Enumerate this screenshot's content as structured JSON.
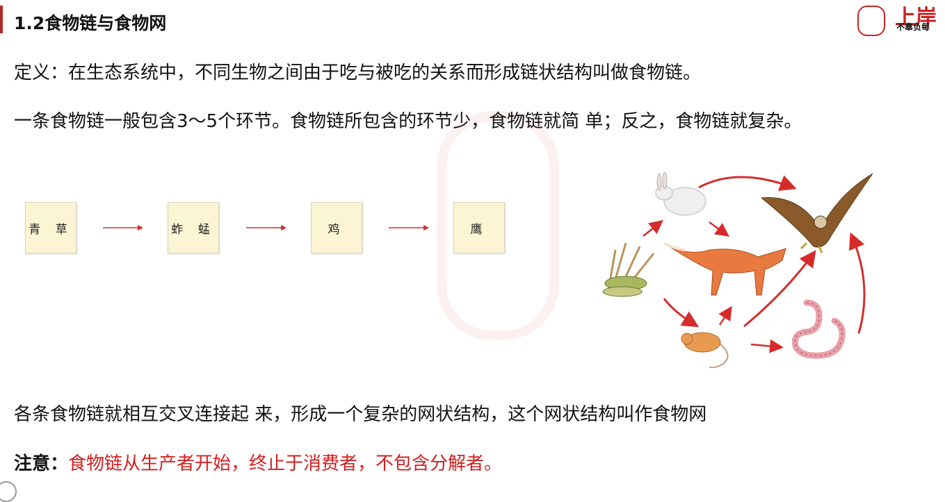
{
  "header": {
    "title": "1.2食物链与食物网",
    "logo_text": "上岸",
    "logo_slogan": "不辜负每"
  },
  "paragraphs": {
    "definition": "定义：在生态系统中，不同生物之间由于吃与被吃的关系而形成链状结构叫做食物链。",
    "links": "一条食物链一般包含3～5个环节。食物链所包含的环节少，食物链就简 单；反之，食物链就复杂。",
    "web": "各条食物链就相互交叉连接起 来，形成一个复杂的网状结构，这个网状结构叫作食物网",
    "note_label": "注意：",
    "note_text": "食物链从生产者开始，终止于消费者，不包含分解者。"
  },
  "food_chain": [
    "青 草",
    "蚱 蜢",
    "鸡",
    "鹰"
  ],
  "colors": {
    "arrow": "#d62b2b",
    "box_fill": "#fcf5d3",
    "note": "#d61d1d",
    "accent": "#b02a2a"
  },
  "icons": [
    "rabbit-icon",
    "eagle-icon",
    "grass-icon",
    "fox-icon",
    "mouse-icon",
    "snake-icon"
  ]
}
